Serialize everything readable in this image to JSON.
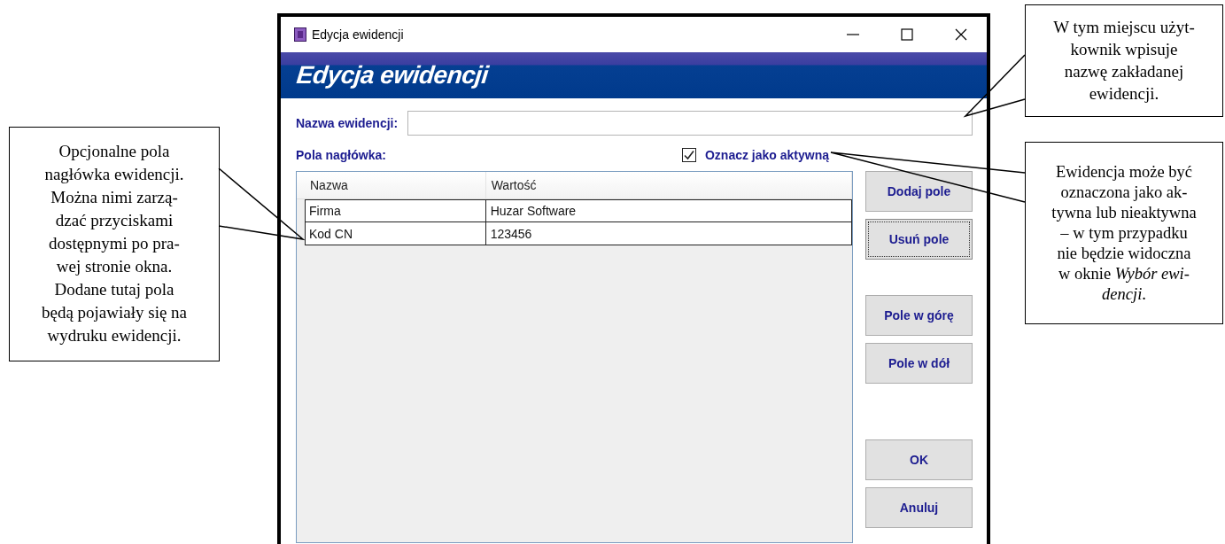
{
  "window": {
    "title": "Edycja ewidencji",
    "banner": "Edycja ewidencji",
    "name_field": {
      "label": "Nazwa ewidencji:"
    },
    "header_fields_label": "Pola nagłówka:",
    "active_checkbox": {
      "label": "Oznacz jako aktywną",
      "checked": true
    },
    "table": {
      "columns": [
        "Nazwa",
        "Wartość"
      ],
      "rows": [
        {
          "cells": [
            "Firma",
            "Huzar Software"
          ]
        },
        {
          "cells": [
            "Kod CN",
            "123456"
          ]
        }
      ]
    },
    "button_groups": [
      {
        "buttons": [
          {
            "label": "Dodaj pole",
            "focused": false
          },
          {
            "label": "Usuń pole",
            "focused": true
          }
        ]
      },
      {
        "buttons": [
          {
            "label": "Pole w górę",
            "focused": false
          },
          {
            "label": "Pole w dół",
            "focused": false
          }
        ]
      },
      {
        "buttons": [
          {
            "label": "OK",
            "focused": false
          },
          {
            "label": "Anuluj",
            "focused": false
          }
        ]
      }
    ]
  },
  "callouts": [
    {
      "kind": "left",
      "text": "Opcjonalne pola\nnagłówka ewidencji.\nMożna nimi zarzą-\ndzać przyciskami\ndostępnymi po pra-\nwej stronie okna.\nDodane tutaj pola\nbędą pojawiały się na\nwydruku ewidencji."
    },
    {
      "kind": "top-right",
      "text": "W tym miejscu użyt-\nkownik wpisuje\nnazwę zakładanej\newidencji."
    },
    {
      "kind": "mid-right",
      "text": "Ewidencja może być\noznaczona jako ak-\ntywna lub nieaktywna\n– w tym przypadku\nnie będzie widoczna\nw oknie *Wybór ewi-*\n*dencji*."
    }
  ]
}
